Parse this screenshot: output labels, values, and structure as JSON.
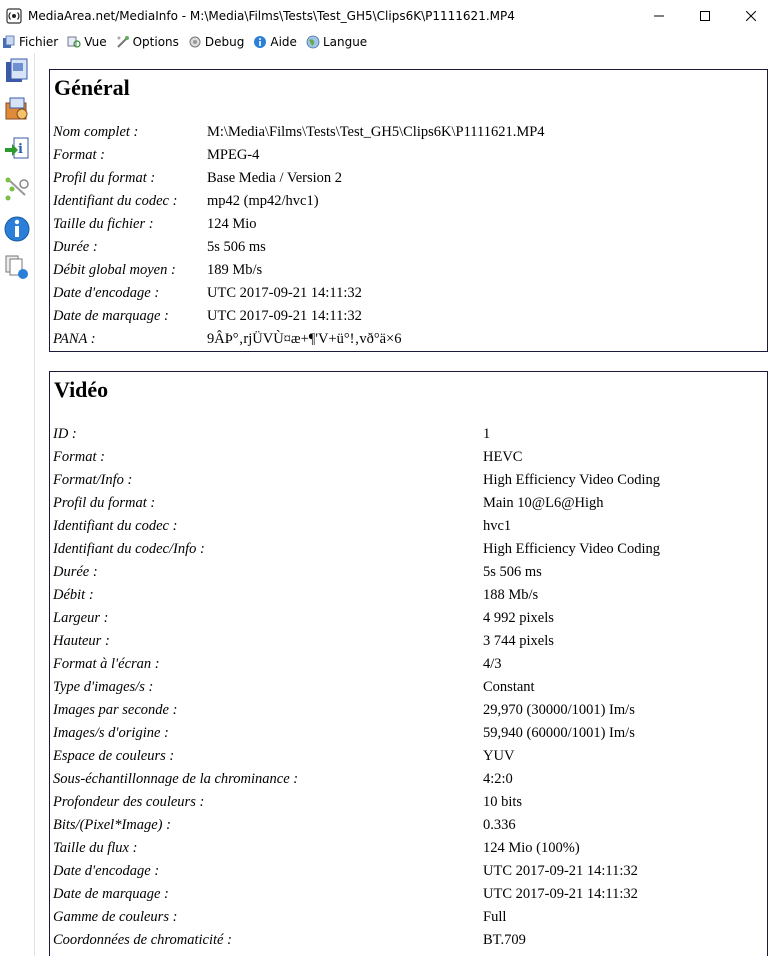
{
  "window": {
    "title": "MediaArea.net/MediaInfo - M:\\Media\\Films\\Tests\\Test_GH5\\Clips6K\\P1111621.MP4"
  },
  "menu": [
    {
      "label": "Fichier",
      "icon": "file-icon"
    },
    {
      "label": "Vue",
      "icon": "view-icon"
    },
    {
      "label": "Options",
      "icon": "options-icon"
    },
    {
      "label": "Debug",
      "icon": "debug-icon"
    },
    {
      "label": "Aide",
      "icon": "help-icon"
    },
    {
      "label": "Langue",
      "icon": "language-globe-icon"
    }
  ],
  "general": {
    "title": "Général",
    "rows": [
      {
        "k": "Nom complet :",
        "v": "M:\\Media\\Films\\Tests\\Test_GH5\\Clips6K\\P1111621.MP4"
      },
      {
        "k": "Format :",
        "v": "MPEG-4"
      },
      {
        "k": "Profil du format :",
        "v": "Base Media / Version 2"
      },
      {
        "k": "Identifiant du codec :",
        "v": "mp42 (mp42/hvc1)"
      },
      {
        "k": "Taille du fichier :",
        "v": "124 Mio"
      },
      {
        "k": "Durée :",
        "v": "5s 506 ms"
      },
      {
        "k": "Débit global moyen :",
        "v": "189 Mb/s"
      },
      {
        "k": "Date d'encodage :",
        "v": "UTC 2017-09-21 14:11:32"
      },
      {
        "k": "Date de marquage :",
        "v": "UTC 2017-09-21 14:11:32"
      },
      {
        "k": "PANA :",
        "v": "9ÂÞ°‚rjÜVÙ¤æ+¶'V+ü°!‚vð°ä×6"
      }
    ]
  },
  "video": {
    "title": "Vidéo",
    "rows": [
      {
        "k": "ID :",
        "v": "1"
      },
      {
        "k": "Format :",
        "v": "HEVC"
      },
      {
        "k": "Format/Info :",
        "v": "High Efficiency Video Coding"
      },
      {
        "k": "Profil du format :",
        "v": "Main 10@L6@High"
      },
      {
        "k": "Identifiant du codec :",
        "v": "hvc1"
      },
      {
        "k": "Identifiant du codec/Info :",
        "v": "High Efficiency Video Coding"
      },
      {
        "k": "Durée :",
        "v": "5s 506 ms"
      },
      {
        "k": "Débit :",
        "v": "188 Mb/s"
      },
      {
        "k": "Largeur :",
        "v": "4 992 pixels"
      },
      {
        "k": "Hauteur :",
        "v": "3 744 pixels"
      },
      {
        "k": "Format à l'écran :",
        "v": "4/3"
      },
      {
        "k": "Type d'images/s :",
        "v": "Constant"
      },
      {
        "k": "Images par seconde :",
        "v": "29,970 (30000/1001) Im/s"
      },
      {
        "k": "Images/s d'origine :",
        "v": "59,940 (60000/1001) Im/s"
      },
      {
        "k": "Espace de couleurs :",
        "v": "YUV"
      },
      {
        "k": "Sous-échantillonnage de la chrominance :",
        "v": "4:2:0"
      },
      {
        "k": "Profondeur des couleurs :",
        "v": "10 bits"
      },
      {
        "k": "Bits/(Pixel*Image) :",
        "v": "0.336"
      },
      {
        "k": "Taille du flux :",
        "v": "124 Mio (100%)"
      },
      {
        "k": "Date d'encodage :",
        "v": "UTC 2017-09-21 14:11:32"
      },
      {
        "k": "Date de marquage :",
        "v": "UTC 2017-09-21 14:11:32"
      },
      {
        "k": "Gamme de couleurs :",
        "v": "Full"
      },
      {
        "k": "Coordonnées de chromaticité :",
        "v": "BT.709"
      }
    ]
  },
  "toolbar": [
    {
      "name": "open-file-icon"
    },
    {
      "name": "open-folder-icon"
    },
    {
      "name": "export-info-icon"
    },
    {
      "name": "tree-view-icon"
    },
    {
      "name": "about-info-icon"
    },
    {
      "name": "sheet-view-icon"
    }
  ]
}
